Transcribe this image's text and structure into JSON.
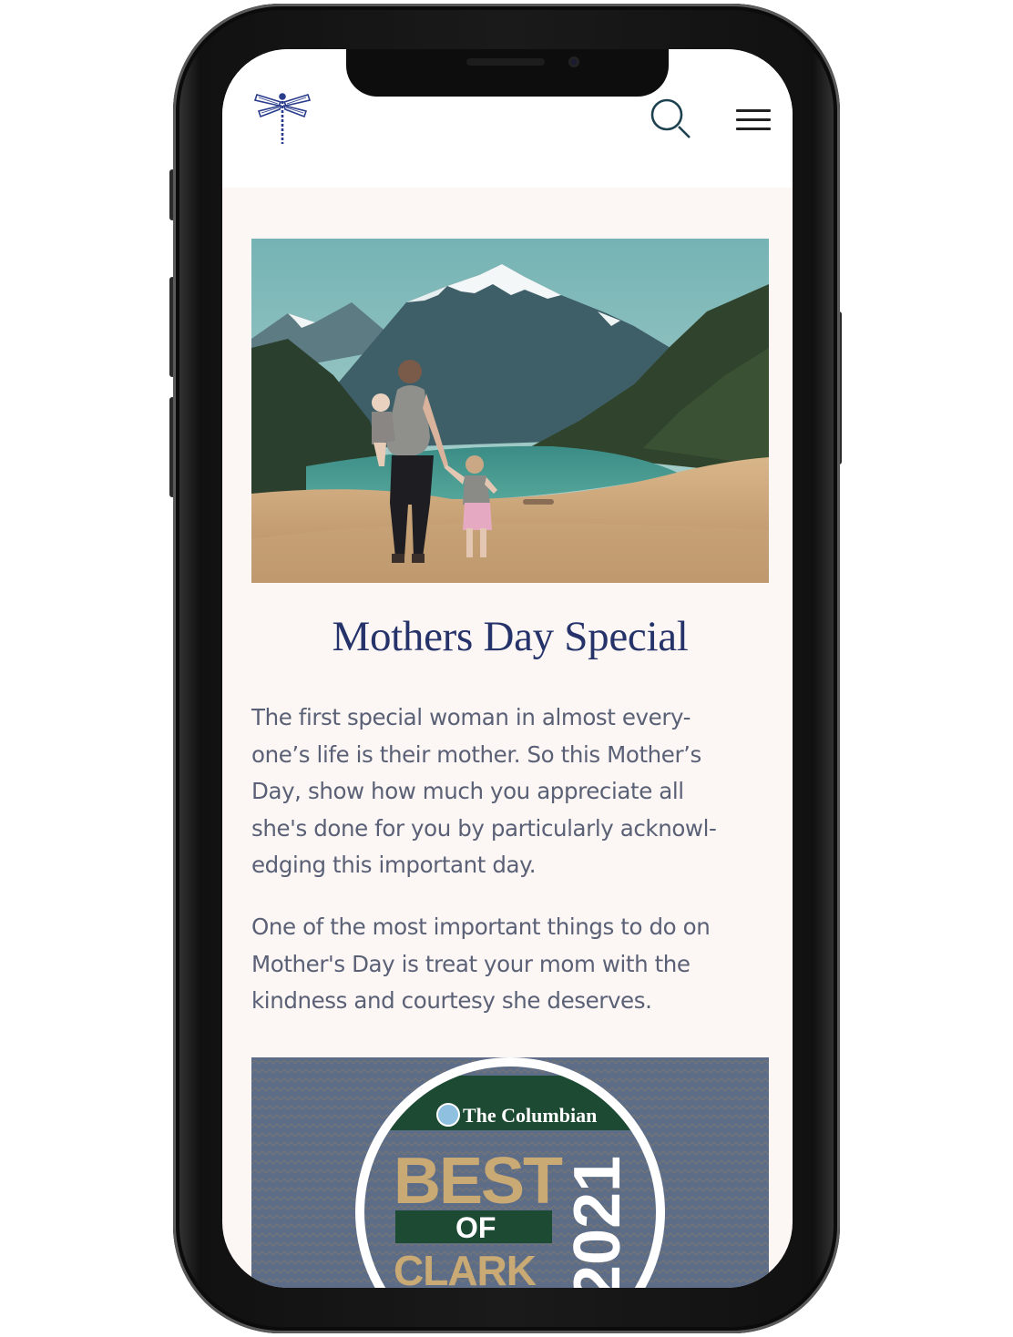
{
  "page": {
    "article_title": "Mothers Day Special",
    "paragraph_1_lines": [
      "The first special woman in almost every-",
      "one’s life is their mother. So this Mother’s",
      "Day, show how much you appreciate all",
      "she's done for you by particularly acknowl-",
      "edging this important day."
    ],
    "paragraph_2_lines": [
      "One of the most important things to do on",
      "Mother's Day is treat your mom with the",
      "kindness and courtesy she deserves."
    ]
  },
  "header": {
    "logo_icon": "dragonfly-icon",
    "search_icon": "search-icon",
    "menu_icon": "hamburger-menu-icon"
  },
  "hero_image": {
    "description_icon": "mountain-lake-photo"
  },
  "award_badge": {
    "publisher": "The Columbian",
    "best": "BEST",
    "of": "OF",
    "region": "CLARK",
    "year": "2021"
  },
  "colors": {
    "title": "#25336a",
    "body_text": "#5a6076",
    "background": "#fcf7f4",
    "logo": "#2a3c8c",
    "award_bg": "#5d6d87",
    "award_gold": "#c9a974",
    "award_green": "#1d4a33"
  }
}
